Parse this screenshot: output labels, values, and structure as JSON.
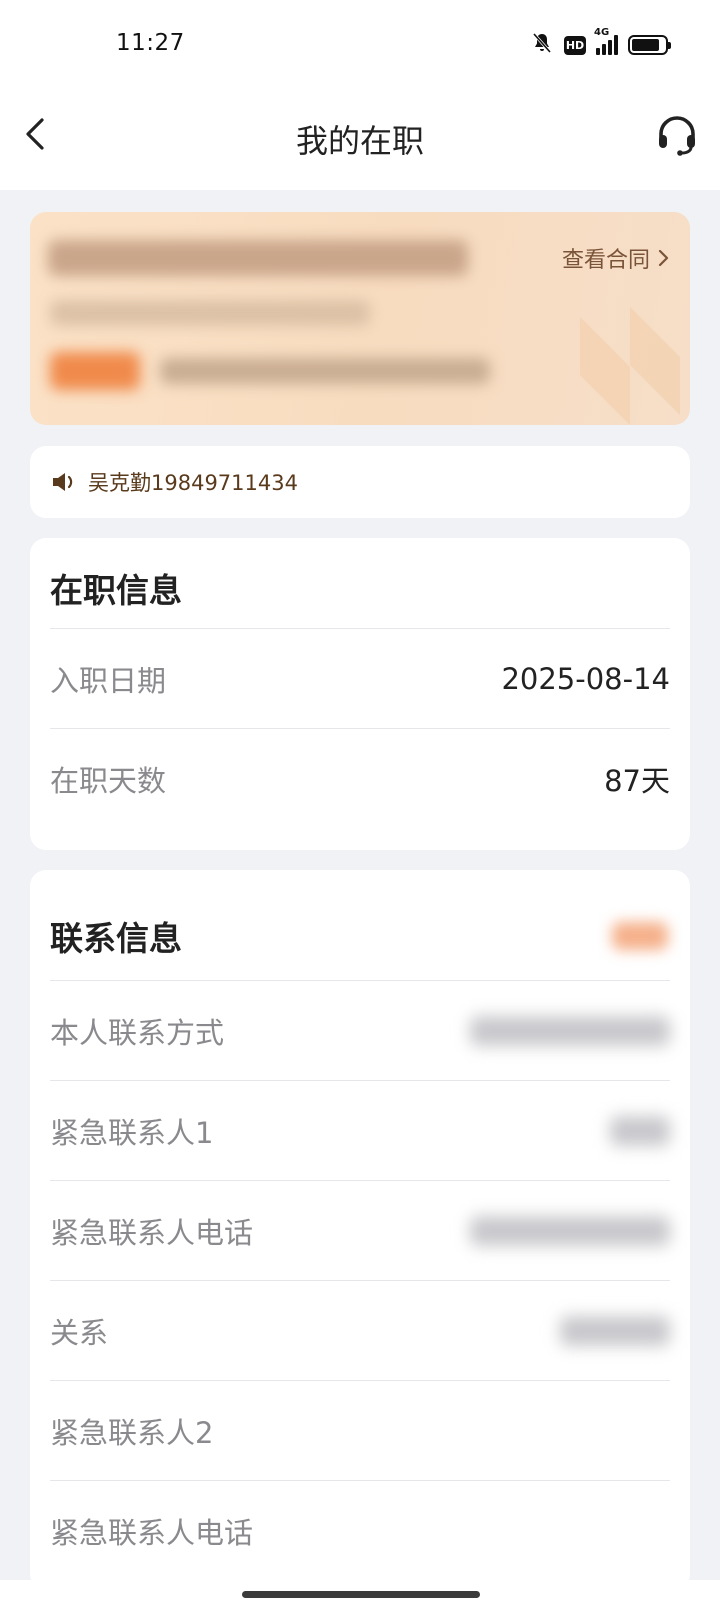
{
  "status_bar": {
    "time": "11:27",
    "network": "4G",
    "hd_label": "HD",
    "battery_level": 0.85,
    "icons": [
      "bell-off-icon",
      "hd-icon",
      "signal-icon",
      "battery-icon"
    ]
  },
  "nav": {
    "title": "我的在职",
    "back_icon": "chevron-left-icon",
    "support_icon": "headset-icon"
  },
  "contract_card": {
    "view_contract_label": "查看合同",
    "colors": {
      "background": "#f8dcc0",
      "link": "#7a5438"
    }
  },
  "notice": {
    "icon": "speaker-icon",
    "text": "吴克勤19849711434"
  },
  "employment_info": {
    "title": "在职信息",
    "rows": [
      {
        "label": "入职日期",
        "value": "2025-08-14"
      },
      {
        "label": "在职天数",
        "value": "87天"
      }
    ]
  },
  "contact_info": {
    "title": "联系信息",
    "rows": [
      {
        "label": "本人联系方式"
      },
      {
        "label": "紧急联系人1"
      },
      {
        "label": "紧急联系人电话"
      },
      {
        "label": "关系"
      },
      {
        "label": "紧急联系人2"
      },
      {
        "label": "紧急联系人电话"
      }
    ]
  },
  "colors": {
    "page_bg": "#f1f2f6",
    "accent": "#f08a4b",
    "label": "#8a8a8e"
  }
}
